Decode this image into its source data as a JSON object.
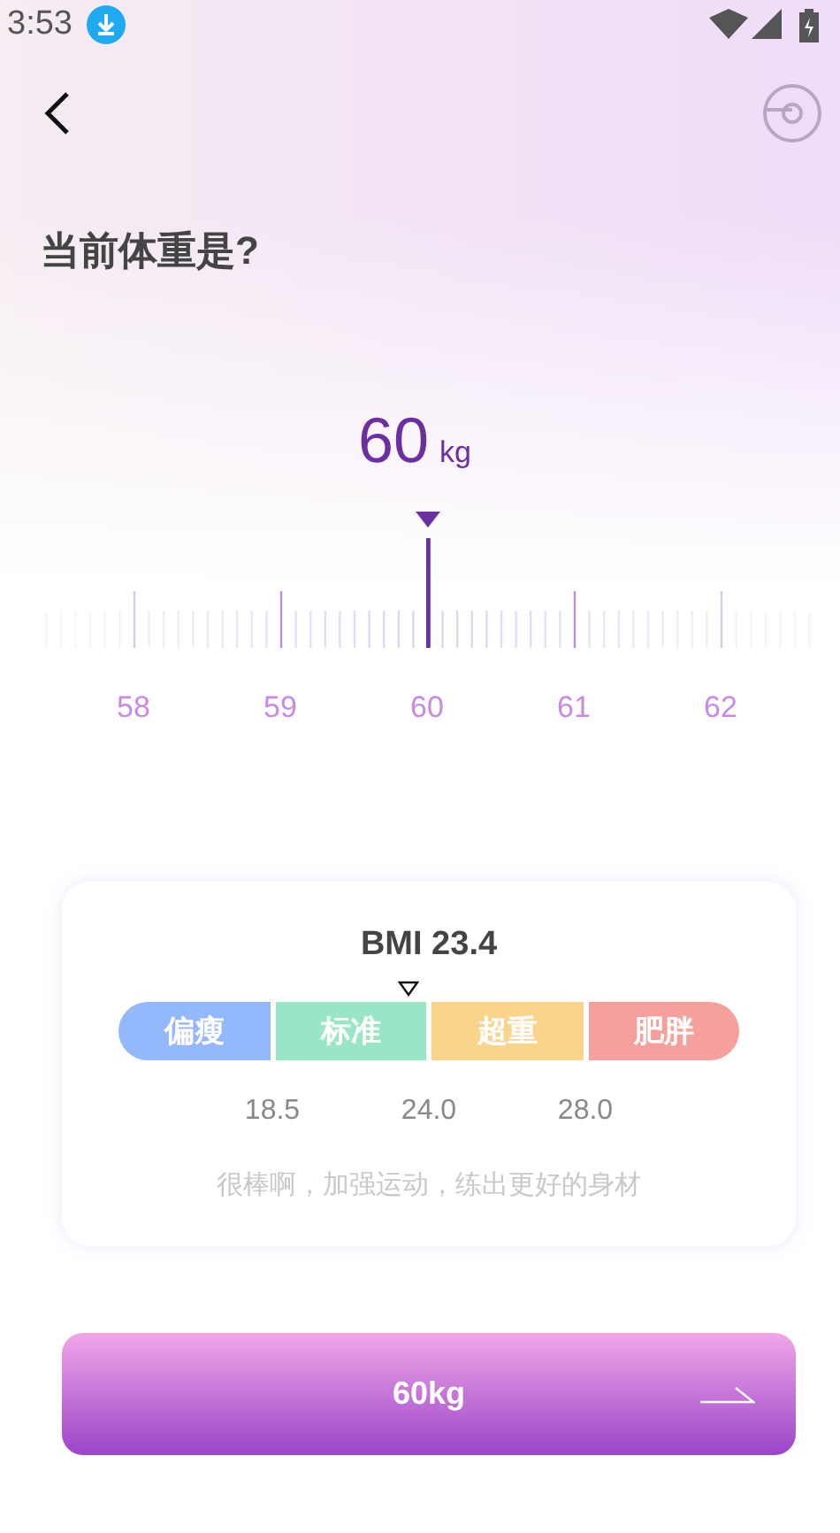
{
  "status_bar": {
    "time": "3:53"
  },
  "title": "当前体重是?",
  "weight": {
    "value": "60",
    "unit": "kg"
  },
  "ruler": {
    "labels": [
      "58",
      "59",
      "60",
      "61",
      "62"
    ]
  },
  "bmi": {
    "title": "BMI 23.4",
    "segments": [
      {
        "label": "偏瘦",
        "color": "#93b8fb"
      },
      {
        "label": "标准",
        "color": "#98e6c6"
      },
      {
        "label": "超重",
        "color": "#fbd48b"
      },
      {
        "label": "肥胖",
        "color": "#f6a09d"
      }
    ],
    "thresholds": [
      "18.5",
      "24.0",
      "28.0"
    ],
    "message": "很棒啊，加强运动，练出更好的身材"
  },
  "confirm_button": {
    "label": "60kg"
  }
}
